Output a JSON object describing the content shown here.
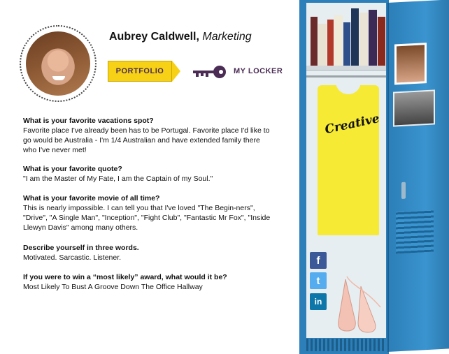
{
  "profile": {
    "name": "Aubrey Caldwell,",
    "department": "Marketing"
  },
  "nav": {
    "portfolio_label": "PORTFOLIO",
    "locker_label": "MY LOCKER"
  },
  "qa": [
    {
      "question": "What is your favorite vacations spot?",
      "answer": "Favorite place I've already been has to be Portugal. Favorite place I'd like to go would be Australia - I'm 1/4 Australian and have extended family there who I've never met!"
    },
    {
      "question": "What is your favorite quote?",
      "answer": "\"I am the Master of My Fate, I am the Captain of my Soul.\""
    },
    {
      "question": "What is your favorite movie of all time?",
      "answer": "This is nearly impossible. I can tell you that I've loved \"The Begin-ners\", \"Drive\", \"A Single Man\", \"Inception\", \"Fight Club\", \"Fantastic Mr Fox\", \"Inside Llewyn Davis\" among many others."
    },
    {
      "question": "Describe yourself in three words.",
      "answer": "Motivated. Sarcastic. Listener."
    },
    {
      "question": "If you were to win a “most likely” award, what would it be?",
      "answer": "Most Likely To Bust A Groove Down The Office Hallway"
    }
  ],
  "locker": {
    "shirt_text": "Creative"
  },
  "social": {
    "facebook": "f",
    "twitter": "t",
    "linkedin": "in"
  },
  "colors": {
    "accent_yellow": "#f7d116",
    "accent_purple": "#4a2c54",
    "locker_blue": "#2c7fb8"
  }
}
